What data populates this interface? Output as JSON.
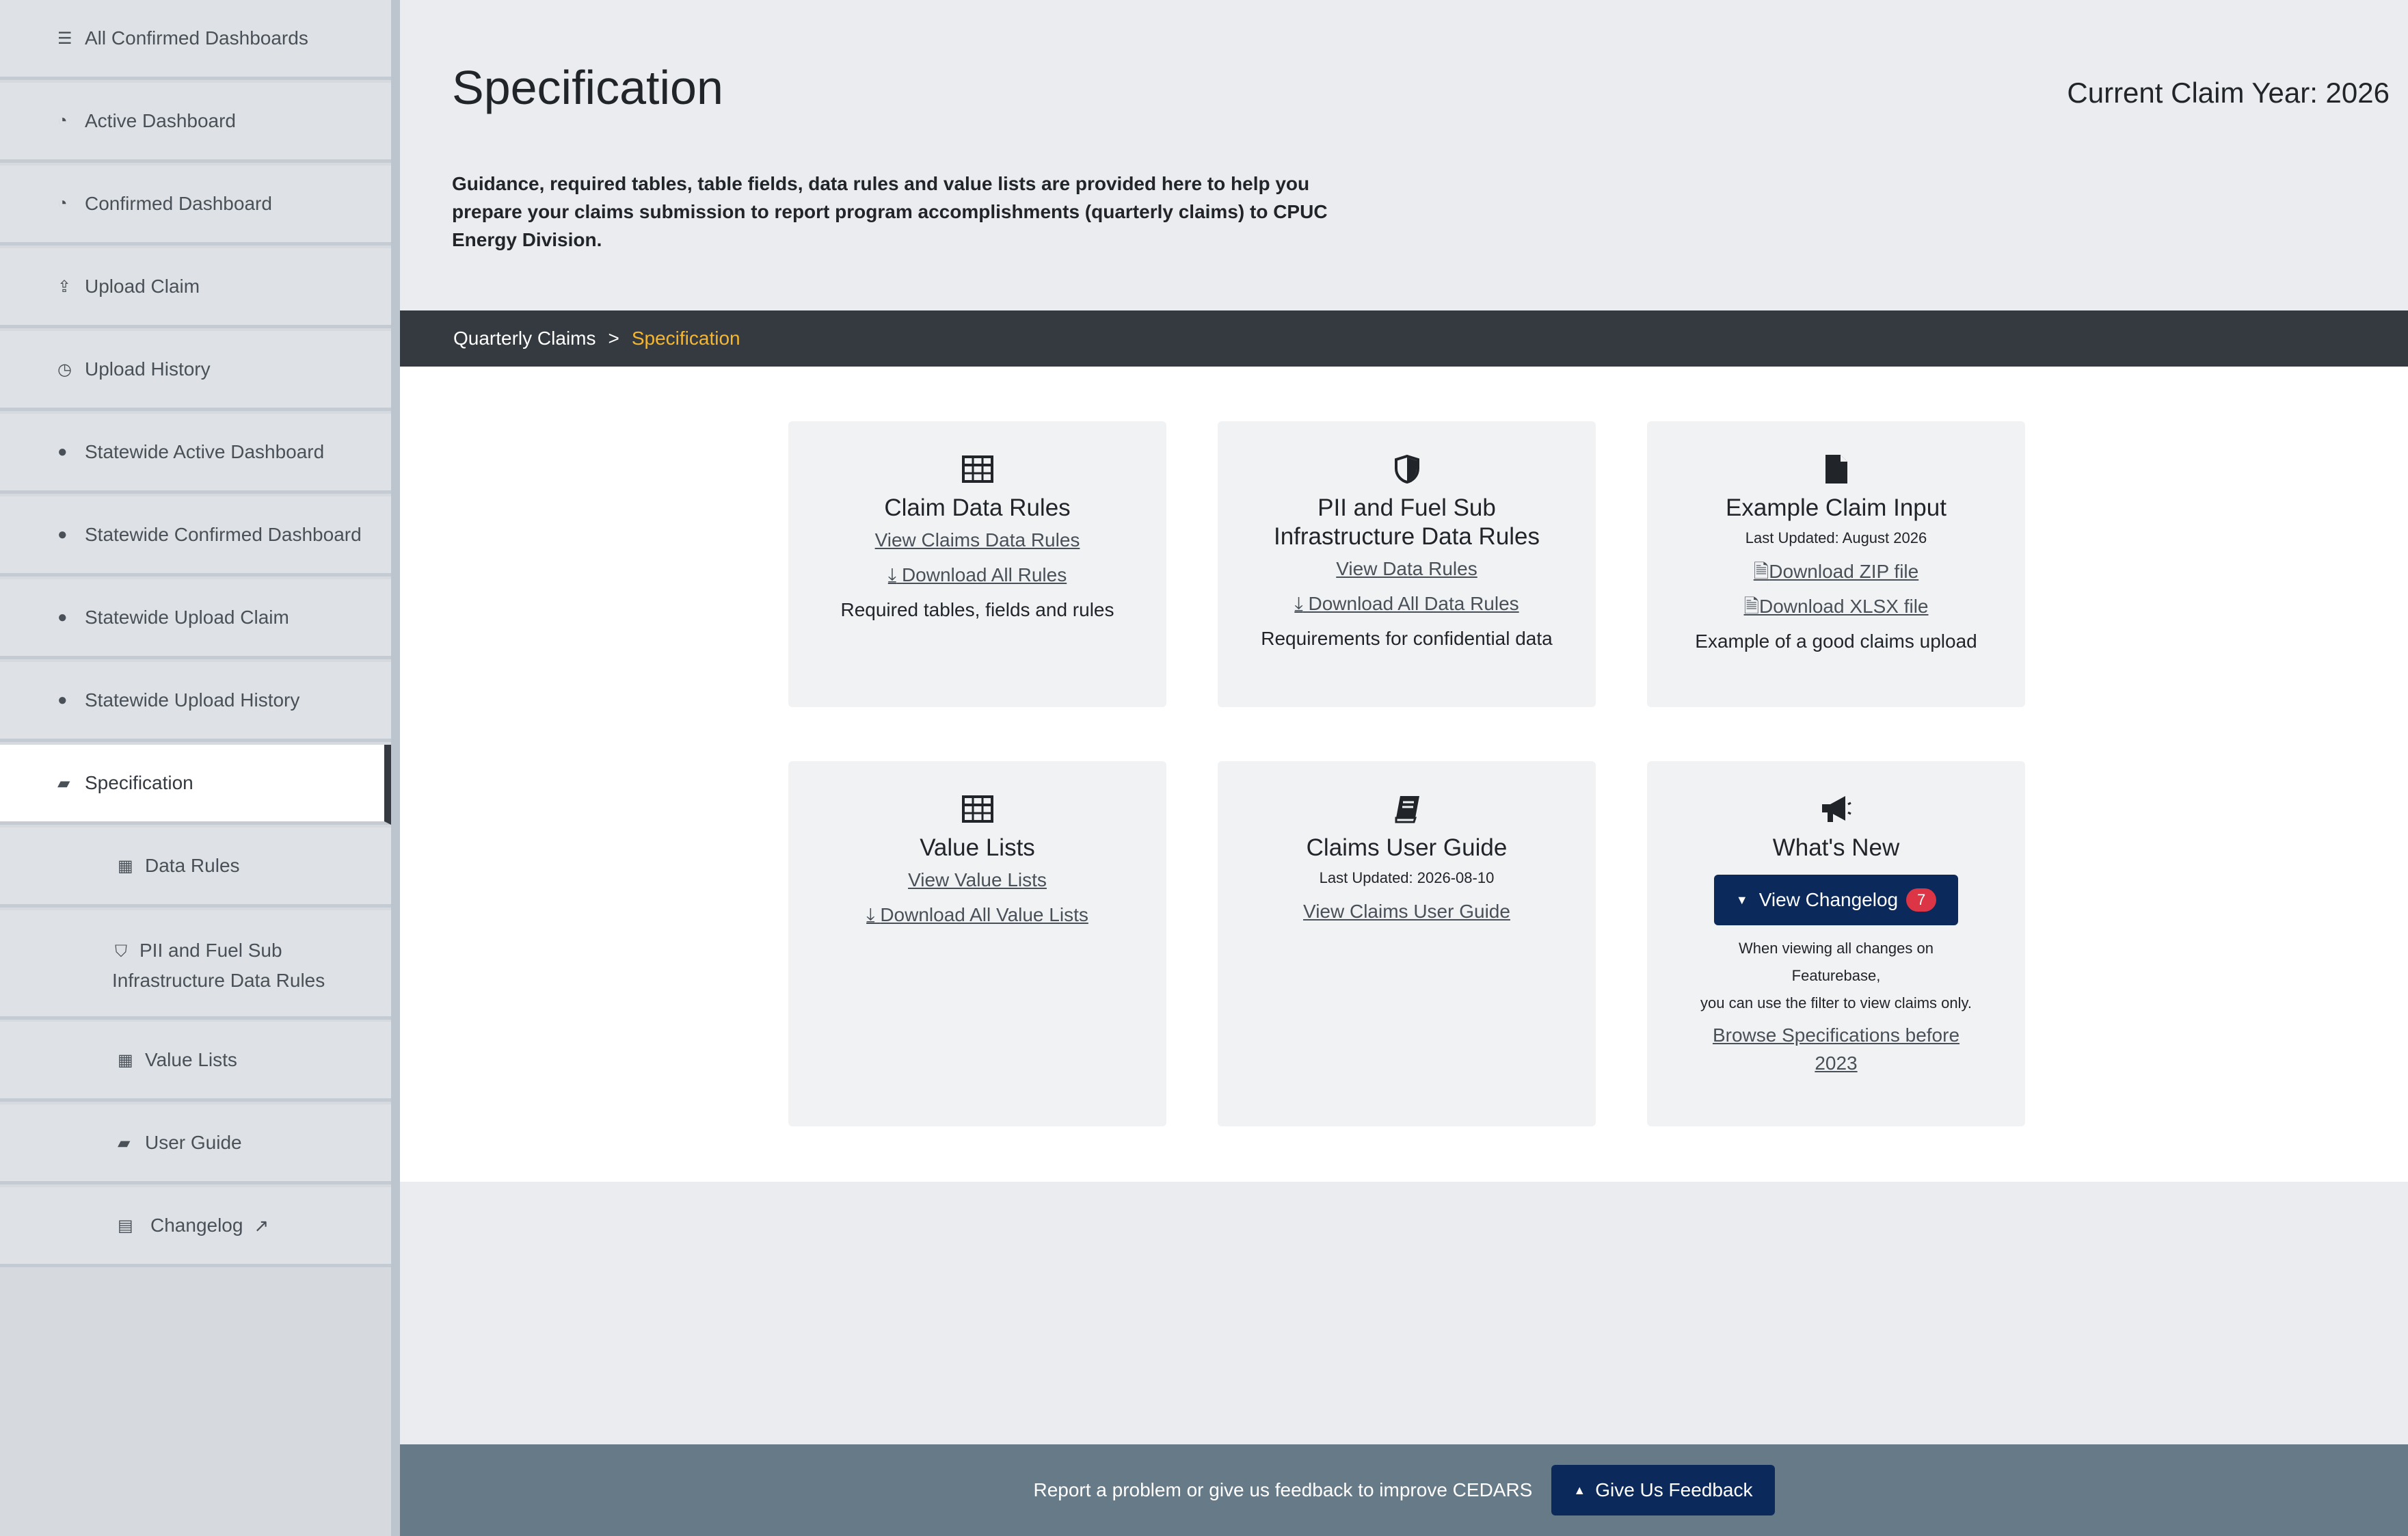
{
  "sidebar": {
    "items": [
      {
        "label": "All Confirmed Dashboards",
        "icon": "list-icon"
      },
      {
        "label": "Active Dashboard",
        "icon": "gauge-icon"
      },
      {
        "label": "Confirmed Dashboard",
        "icon": "gauge-icon"
      },
      {
        "label": "Upload Claim",
        "icon": "upload-icon"
      },
      {
        "label": "Upload History",
        "icon": "clock-icon"
      },
      {
        "label": "Statewide Active Dashboard",
        "icon": "globe-icon"
      },
      {
        "label": "Statewide Confirmed Dashboard",
        "icon": "globe-icon"
      },
      {
        "label": "Statewide Upload Claim",
        "icon": "globe-icon"
      },
      {
        "label": "Statewide Upload History",
        "icon": "globe-icon"
      },
      {
        "label": "Specification",
        "icon": "book-icon",
        "active": true
      }
    ],
    "subitems": [
      {
        "label": "Data Rules",
        "icon": "table-icon"
      },
      {
        "label_line1": "PII and Fuel Sub",
        "label_line2": "Infrastructure Data Rules",
        "icon": "shield-icon"
      },
      {
        "label": "Value Lists",
        "icon": "table-icon"
      },
      {
        "label": "User Guide",
        "icon": "book-icon"
      },
      {
        "label": "Changelog",
        "icon": "newspaper-icon",
        "external_icon": "external-link-icon"
      }
    ]
  },
  "header": {
    "title": "Specification",
    "claim_year": "Current Claim Year: 2026",
    "intro": "Guidance, required tables, table fields, data rules and value lists are provided here to help you prepare your claims submission to report program accomplishments (quarterly claims) to CPUC Energy Division."
  },
  "breadcrumb": {
    "parent": "Quarterly Claims",
    "separator": ">",
    "current": "Specification"
  },
  "cards": {
    "claim_rules": {
      "icon": "table-icon",
      "title": "Claim Data Rules",
      "link1": "View Claims Data Rules",
      "link2": "Download All Rules",
      "desc": "Required tables, fields and rules"
    },
    "pii_rules": {
      "icon": "shield-icon",
      "title_line1": "PII and Fuel Sub",
      "title_line2": "Infrastructure Data Rules",
      "link1": "View Data Rules",
      "link2": "Download All Data Rules",
      "desc": "Requirements for confidential data"
    },
    "example_input": {
      "icon": "file-icon",
      "title": "Example Claim Input",
      "updated": "Last Updated: August 2026",
      "link1": "Download ZIP file",
      "link2": "Download XLSX file",
      "desc": "Example of a good claims upload"
    },
    "value_lists": {
      "icon": "table-icon",
      "title": "Value Lists",
      "link1": "View Value Lists",
      "link2": "Download All Value Lists"
    },
    "user_guide": {
      "icon": "book-icon",
      "title": "Claims User Guide",
      "updated": "Last Updated: 2026-08-10",
      "link1": "View Claims User Guide"
    },
    "whats_new": {
      "icon": "megaphone-icon",
      "title": "What's New",
      "button": "View Changelog",
      "badge": "7",
      "note1": "When viewing all changes on",
      "note2": "Featurebase,",
      "note3": "you can use the filter to view claims only.",
      "browse_line1": "Browse Specifications before",
      "browse_line2": "2023"
    }
  },
  "footer": {
    "text": "Report a problem or give us feedback to improve CEDARS",
    "button": "Give Us Feedback"
  },
  "colors": {
    "nav_dark": "#343a40",
    "breadcrumb_current": "#f5b731",
    "primary_button": "#0b2a5b",
    "badge": "#dc3545",
    "footer_bg": "#677a88"
  }
}
